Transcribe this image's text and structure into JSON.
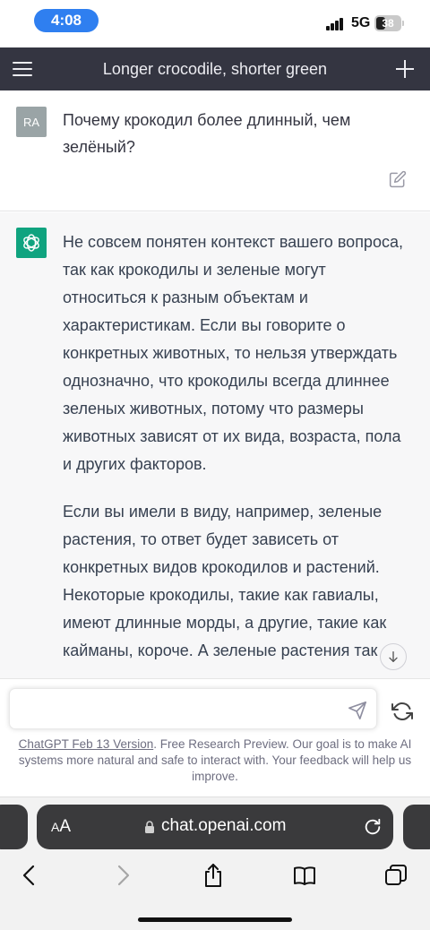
{
  "status_bar": {
    "time": "4:08",
    "network": "5G",
    "battery": "38"
  },
  "topbar": {
    "title": "Longer crocodile, shorter green"
  },
  "user_message": {
    "avatar_initials": "RA",
    "text": "Почему крокодил более длинный, чем зелёный?"
  },
  "assistant_message": {
    "paragraphs": [
      "Не совсем понятен контекст вашего вопроса, так как крокодилы и зеленые могут относиться к разным объектам и характеристикам. Если вы говорите о конкретных животных, то нельзя утверждать однозначно, что крокодилы всегда длиннее зеленых животных, потому что размеры животных зависят от их вида, возраста, пола и других факторов.",
      "Если вы имели в виду, например, зеленые растения, то ответ будет зависеть от конкретных видов крокодилов и растений. Некоторые крокодилы, такие как гавиалы, имеют длинные морды, а другие, такие как кайманы, короче. А зеленые растения так"
    ]
  },
  "composer": {
    "input_value": "",
    "input_placeholder": "",
    "disclaimer_link": "ChatGPT Feb 13 Version",
    "disclaimer_text": ". Free Research Preview. Our goal is to make AI systems more natural and safe to interact with. Your feedback will help us improve."
  },
  "safari": {
    "aa_label_small": "A",
    "aa_label_large": "A",
    "url": "chat.openai.com"
  },
  "colors": {
    "nav_background": "#343541",
    "assistant_background": "#f7f7f8",
    "gpt_green": "#10a37f",
    "status_time_pill": "#2f7ff0"
  },
  "icons": [
    "menu-icon",
    "plus-icon",
    "edit-icon",
    "openai-logo-icon",
    "arrow-down-icon",
    "send-icon",
    "regenerate-icon",
    "lock-icon",
    "reload-icon",
    "back-icon",
    "forward-icon",
    "share-icon",
    "bookmarks-icon",
    "tabs-icon"
  ]
}
